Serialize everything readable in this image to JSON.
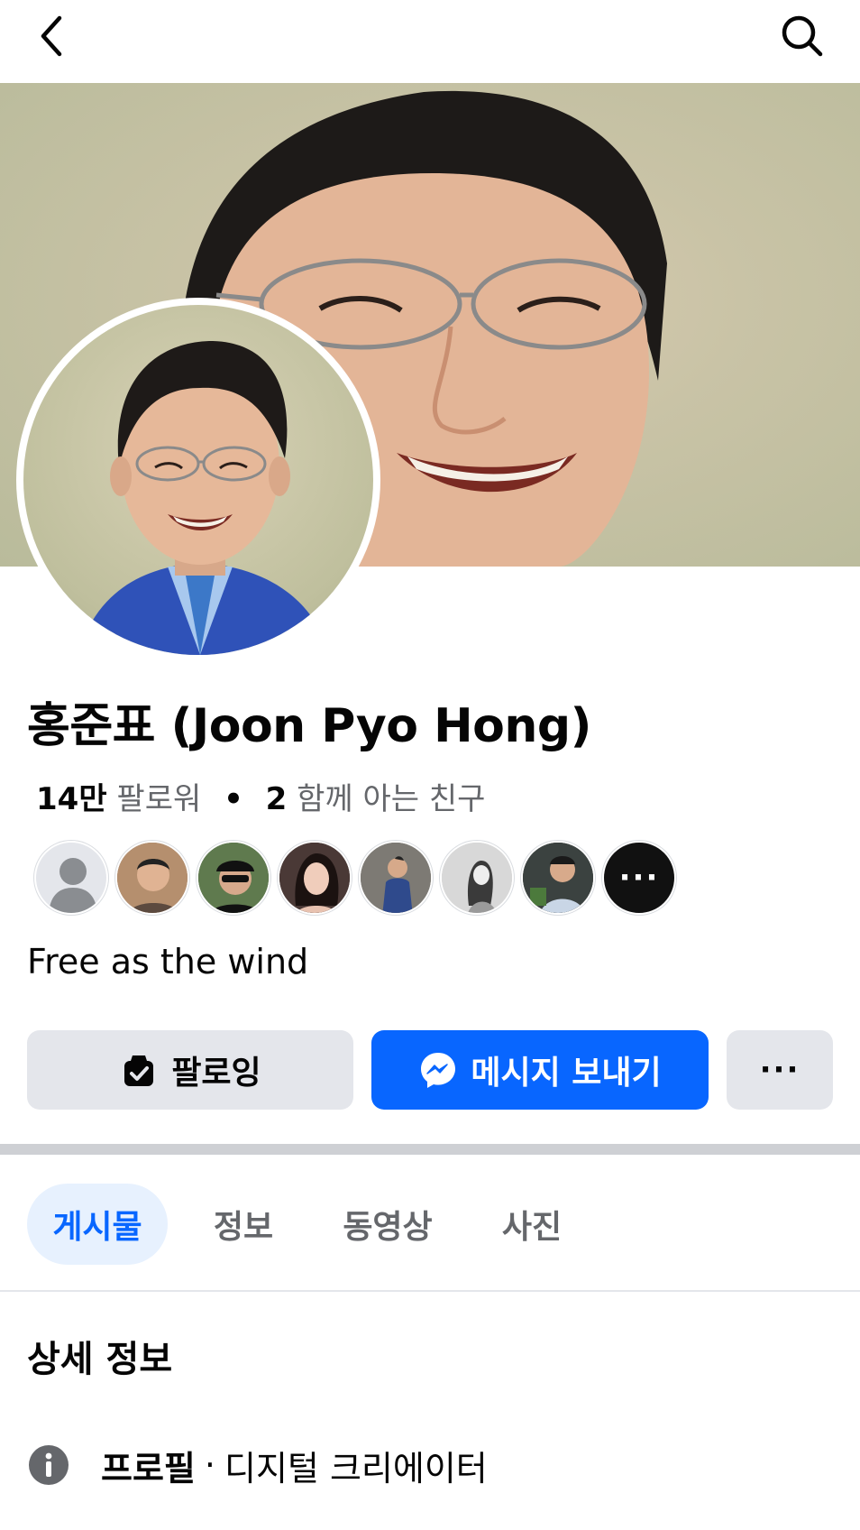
{
  "profile": {
    "name": "홍준표 (Joon Pyo Hong)",
    "followers_count": "14만",
    "followers_label": "팔로워",
    "mutual_count": "2",
    "mutual_label": "함께 아는 친구",
    "bio": "Free as the wind"
  },
  "mutual_friends": [
    "avatar-default",
    "friend-2",
    "friend-3",
    "friend-4",
    "friend-5",
    "friend-6",
    "friend-7"
  ],
  "mutual_more_label": "···",
  "actions": {
    "follow_label": "팔로잉",
    "message_label": "메시지 보내기",
    "more_label": "···"
  },
  "tabs": [
    {
      "label": "게시물",
      "active": true
    },
    {
      "label": "정보",
      "active": false
    },
    {
      "label": "동영상",
      "active": false
    },
    {
      "label": "사진",
      "active": false
    }
  ],
  "details": {
    "title": "상세 정보",
    "items": [
      {
        "label": "프로필",
        "value": "디지털 크리에이터"
      }
    ]
  },
  "colors": {
    "accent": "#0866ff",
    "button_gray": "#e4e6eb",
    "tab_active_bg": "#e7f1fe"
  },
  "icons": {
    "back": "chevron-left-icon",
    "search": "search-icon",
    "follow": "following-check-icon",
    "message": "messenger-icon",
    "info": "info-icon"
  }
}
